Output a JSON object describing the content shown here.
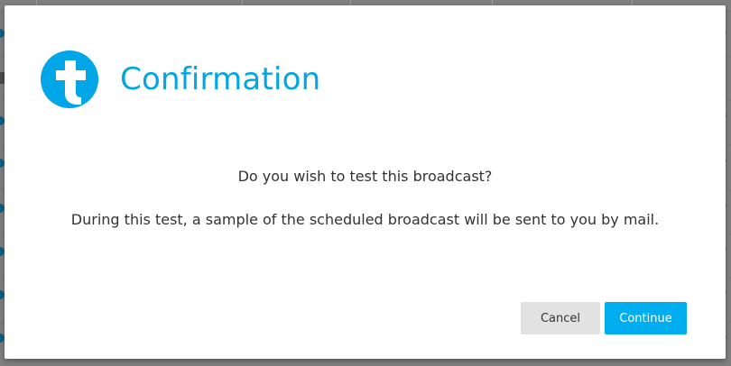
{
  "dialog": {
    "title": "Confirmation",
    "question": "Do you wish to test this broadcast?",
    "description": "During this test, a sample of the scheduled broadcast will be sent to you by mail.",
    "buttons": {
      "cancel_label": "Cancel",
      "continue_label": "Continue"
    },
    "logo_icon": "cross-logo-icon"
  },
  "colors": {
    "accent": "#00a6e6",
    "primary_button": "#00aeef",
    "secondary_button": "#e2e2e2",
    "text": "#333333",
    "overlay": "#7f7f7f"
  }
}
